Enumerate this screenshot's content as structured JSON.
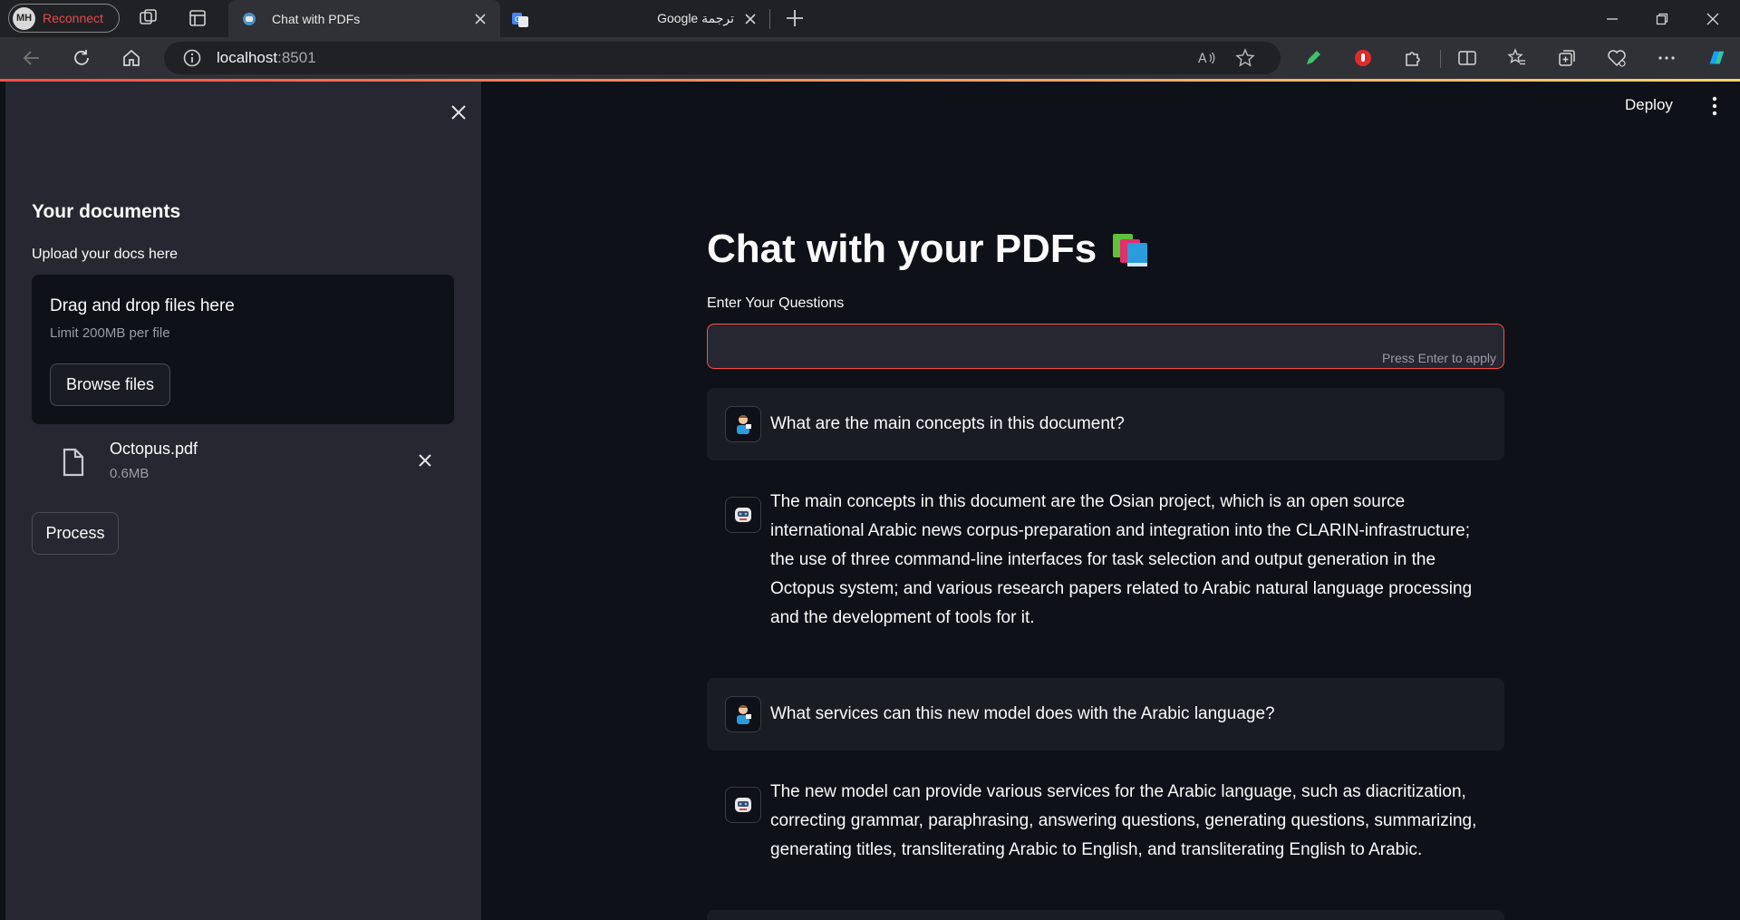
{
  "browser": {
    "profile_initials": "MH",
    "profile_status": "Reconnect",
    "active_tab_title": "Chat with PDFs",
    "inactive_tab_title": "Google ترجمة",
    "url_host": "localhost",
    "url_port": ":8501"
  },
  "header": {
    "deploy_label": "Deploy"
  },
  "sidebar": {
    "heading": "Your documents",
    "upload_label": "Upload your docs here",
    "dropzone_title": "Drag and drop files here",
    "dropzone_limit": "Limit 200MB per file",
    "browse_button": "Browse files",
    "file_name": "Octopus.pdf",
    "file_size": "0.6MB",
    "process_button": "Process"
  },
  "main": {
    "title": "Chat with your PDFs",
    "input_label": "Enter Your Questions",
    "input_value": "",
    "input_hint": "Press Enter to apply",
    "messages": [
      {
        "role": "user",
        "text": "What are the main concepts in this document?"
      },
      {
        "role": "bot",
        "text": "The main concepts in this document are the Osian project, which is an open source international Arabic news corpus-preparation and integration into the CLARIN-infrastructure; the use of three command-line interfaces for task selection and output generation in the Octopus system; and various research papers related to Arabic natural language processing and the development of tools for it."
      },
      {
        "role": "user",
        "text": "What services can this new model does with the Arabic language?"
      },
      {
        "role": "bot",
        "text": "The new model can provide various services for the Arabic language, such as diacritization, correcting grammar, paraphrasing, answering questions, generating questions, summarizing, generating titles, transliterating Arabic to English, and transliterating English to Arabic."
      }
    ]
  },
  "colors": {
    "accent": "#ff4b4b",
    "sidebar_bg": "#262730",
    "main_bg": "#0e1117",
    "user_msg_bg": "#1a1c24"
  }
}
